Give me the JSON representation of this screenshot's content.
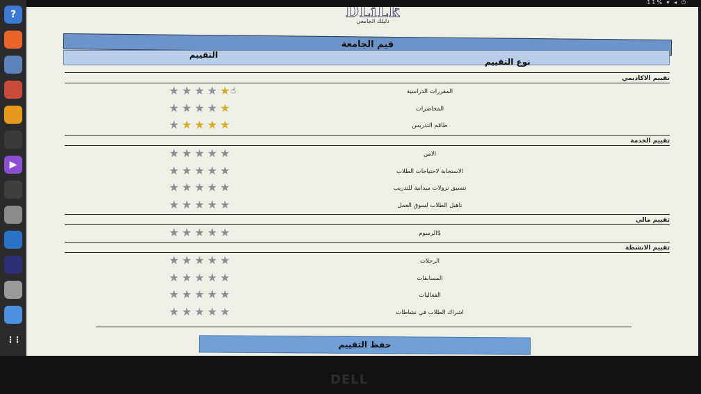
{
  "dock": {
    "icons": [
      {
        "name": "help-icon",
        "glyph": "?",
        "color": "#3b7bd6"
      },
      {
        "name": "firefox-icon",
        "glyph": "",
        "color": "#e8642b"
      },
      {
        "name": "postgresql-icon",
        "glyph": "",
        "color": "#5b83b8"
      },
      {
        "name": "calculator-icon",
        "glyph": "",
        "color": "#c94a3a"
      },
      {
        "name": "rhythmbox-icon",
        "glyph": "",
        "color": "#e89a1c"
      },
      {
        "name": "terminal-icon",
        "glyph": "",
        "color": "#3a3a3a"
      },
      {
        "name": "video-player-icon",
        "glyph": "▶",
        "color": "#8d4fd2"
      },
      {
        "name": "android-tools-icon",
        "glyph": "",
        "color": "#3f3f3f"
      },
      {
        "name": "text-editor-icon",
        "glyph": "",
        "color": "#8a8a8a"
      },
      {
        "name": "vscode-icon",
        "glyph": "",
        "color": "#2b73c7"
      },
      {
        "name": "eclipse-icon",
        "glyph": "",
        "color": "#2c2f74"
      },
      {
        "name": "files-icon",
        "glyph": "",
        "color": "#9a9a9a"
      },
      {
        "name": "chrome-icon",
        "glyph": "",
        "color": "#4a8fe0"
      },
      {
        "name": "app-grid-icon",
        "glyph": "⋮⋮",
        "color": "#2b2b2e"
      }
    ]
  },
  "topbar": {
    "indicators": "11%  ▾ ◂ ⏻"
  },
  "logo": {
    "text": "DLiLk",
    "subtitle": "دليلك الجامعي"
  },
  "page": {
    "title": "قيم الجامعة",
    "col_type": "نوع التقييم",
    "col_rating": "التقييم",
    "save_label": "حفظ التقييم"
  },
  "sections": [
    {
      "title": "تقييم الاكاديمي",
      "items": [
        {
          "label": "المقررات الدراسية",
          "rating": 0.5
        },
        {
          "label": "المحاضرات",
          "rating": 1
        },
        {
          "label": "طاقم التدريس",
          "rating": 4
        }
      ]
    },
    {
      "title": "تقييم الخدمة",
      "items": [
        {
          "label": "الامن",
          "rating": 0
        },
        {
          "label": "الاستجابة لاحتياجات الطلاب",
          "rating": 0
        },
        {
          "label": "تنسيق نزولات ميدانية للتدريب",
          "rating": 0
        },
        {
          "label": "تاهيل الطلاب لسوق العمل",
          "rating": 0
        }
      ]
    },
    {
      "title": "تقييم مالي",
      "items": [
        {
          "label": "الرسوم$",
          "rating": 0
        }
      ]
    },
    {
      "title": "تقييم الانشطة",
      "items": [
        {
          "label": "الرحلات",
          "rating": 0
        },
        {
          "label": "المسابقات",
          "rating": 0
        },
        {
          "label": "الفعاليات",
          "rating": 0
        },
        {
          "label": "اشراك الطلاب في نشاطات",
          "rating": 0
        }
      ]
    }
  ],
  "colors": {
    "accent": "#6d94c8",
    "star_filled": "#d8a923",
    "star_empty": "#8a8e96"
  },
  "bezel": {
    "brand": "DELL"
  }
}
